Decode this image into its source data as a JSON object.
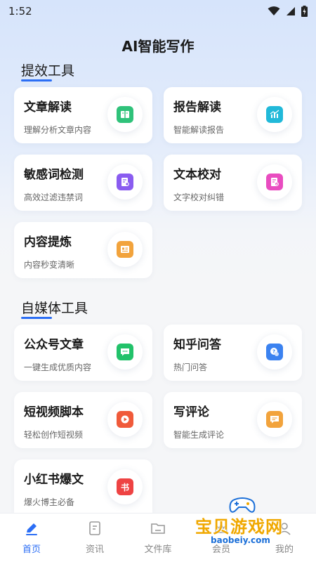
{
  "status_bar": {
    "time": "1:52"
  },
  "app_title": "AI智能写作",
  "sections": [
    {
      "title": "提效工具",
      "cards": [
        {
          "title": "文章解读",
          "subtitle": "理解分析文章内容",
          "icon": "book-icon",
          "color": "#2fc27a"
        },
        {
          "title": "报告解读",
          "subtitle": "智能解读报告",
          "icon": "chart-icon",
          "color": "#21b9d9"
        },
        {
          "title": "敏感词检测",
          "subtitle": "高效过滤违禁词",
          "icon": "document-search-icon",
          "color": "#8a5cf0"
        },
        {
          "title": "文本校对",
          "subtitle": "文字校对纠错",
          "icon": "document-check-icon",
          "color": "#e94cc0"
        },
        {
          "title": "内容提炼",
          "subtitle": "内容秒变清晰",
          "icon": "id-card-icon",
          "color": "#f2a33c"
        }
      ]
    },
    {
      "title": "自媒体工具",
      "cards": [
        {
          "title": "公众号文章",
          "subtitle": "一键生成优质内容",
          "icon": "chat-bubble-icon",
          "color": "#22c26a"
        },
        {
          "title": "知乎问答",
          "subtitle": "热门问答",
          "icon": "question-bubble-icon",
          "color": "#3b82f0"
        },
        {
          "title": "短视频脚本",
          "subtitle": "轻松创作短视频",
          "icon": "play-icon",
          "color": "#f05a3a"
        },
        {
          "title": "写评论",
          "subtitle": "智能生成评论",
          "icon": "comment-icon",
          "color": "#f2a33c"
        },
        {
          "title": "小红书爆文",
          "subtitle": "爆火博主必备",
          "icon": "book-badge-icon",
          "color": "#ee4343",
          "badge": "书"
        }
      ]
    }
  ],
  "tabs": [
    {
      "label": "首页",
      "icon": "pen-icon",
      "active": true
    },
    {
      "label": "资讯",
      "icon": "news-icon",
      "active": false
    },
    {
      "label": "文件库",
      "icon": "folder-icon",
      "active": false
    },
    {
      "label": "会员",
      "icon": "crown-icon",
      "active": false
    },
    {
      "label": "我的",
      "icon": "user-icon",
      "active": false
    }
  ],
  "colors": {
    "accent": "#2b6ef5"
  },
  "watermark": {
    "text": "宝贝游戏网",
    "url": "baobeiy.com"
  }
}
